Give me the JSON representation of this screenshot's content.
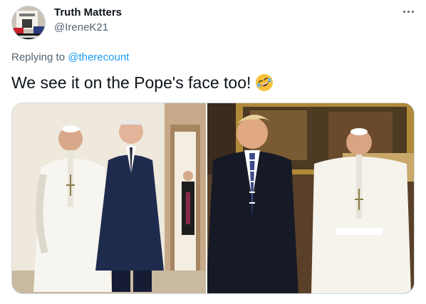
{
  "tweet": {
    "author": {
      "name": "Truth Matters",
      "handle": "@IreneK21"
    },
    "replying_prefix": "Replying to",
    "replying_to": "@therecount",
    "text": "We see it on the Pope's face too!",
    "emoji": "rolling-on-floor-laughing",
    "more_icon": "more-horizontal-icon"
  },
  "media": {
    "photos": [
      {
        "alt": "Photo with the Pope and Joe Biden"
      },
      {
        "alt": "Photo with Donald Trump and the Pope"
      }
    ]
  },
  "colors": {
    "link": "#1d9bf0",
    "secondary_text": "#536471",
    "border": "#cfd9de"
  }
}
